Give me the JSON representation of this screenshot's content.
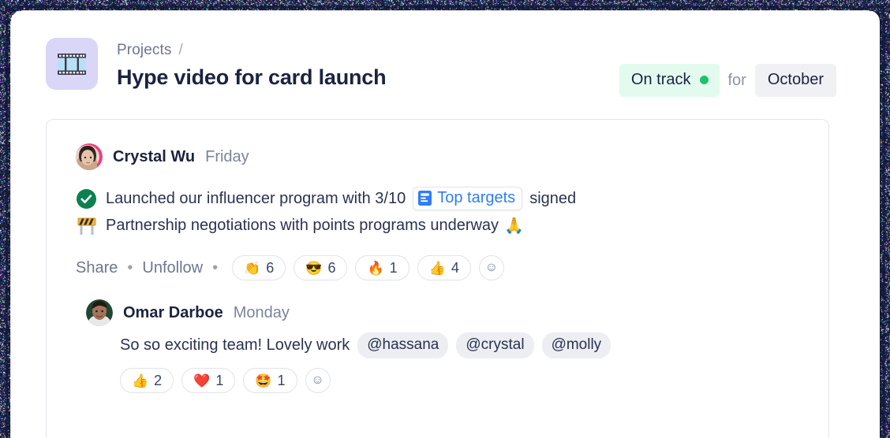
{
  "header": {
    "project_icon": "film-frames-icon",
    "breadcrumb": "Projects",
    "breadcrumb_separator": "/",
    "title": "Hype video for card launch",
    "status_label": "On track",
    "status_color": "#1fc16b",
    "status_bg": "#e2fbee",
    "for_label": "for",
    "period_label": "October"
  },
  "update": {
    "author": "Crystal Wu",
    "time": "Friday",
    "avatar": "crystal-wu-avatar",
    "lines": [
      {
        "icon": "green-check-icon",
        "text_before": "Launched our influencer program with 3/10",
        "doc_chip": "Top targets",
        "doc_chip_icon": "document-icon",
        "text_after": "signed"
      },
      {
        "icon": "construction-barrier-icon",
        "text_before": "Partnership negotiations with points programs underway",
        "doc_chip": "",
        "doc_chip_icon": "",
        "text_after": "🙏"
      }
    ],
    "share_label": "Share",
    "unfollow_label": "Unfollow",
    "separator": "•",
    "reactions": [
      {
        "emoji": "👏",
        "name": "clap-reaction",
        "count": "6"
      },
      {
        "emoji": "😎",
        "name": "sunglasses-reaction",
        "count": "6"
      },
      {
        "emoji": "🔥",
        "name": "fire-reaction",
        "count": "1"
      },
      {
        "emoji": "👍",
        "name": "thumbsup-reaction",
        "count": "4"
      }
    ],
    "add_reaction_icon": "☺"
  },
  "reply": {
    "author": "Omar Darboe",
    "time": "Monday",
    "avatar": "omar-darboe-avatar",
    "text": "So so exciting team! Lovely work",
    "mentions": [
      "@hassana",
      "@crystal",
      "@molly"
    ],
    "reactions": [
      {
        "emoji": "👍",
        "name": "thumbsup-reaction",
        "count": "2"
      },
      {
        "emoji": "❤️",
        "name": "heart-reaction",
        "count": "1"
      },
      {
        "emoji": "🤩",
        "name": "star-struck-reaction",
        "count": "1"
      }
    ],
    "add_reaction_icon": "☺"
  }
}
